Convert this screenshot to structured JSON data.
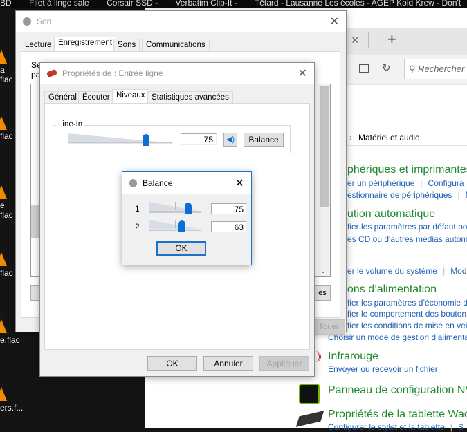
{
  "taskbar": {
    "items": [
      "BD",
      "Filet à linge sale",
      "Corsair SSD -",
      "Verbatim Clip-It -",
      "Têtard - Lausanne Les écoles - AGEP  Kold Krew - Don't"
    ]
  },
  "desktop": {
    "labels": [
      "a",
      "flac",
      "flac",
      "e",
      "flac",
      "flac",
      "e.flac",
      "ers.f..."
    ]
  },
  "browser": {
    "tab_close": "×",
    "new_tab": "+",
    "search_placeholder": "Rechercher"
  },
  "control_panel": {
    "breadcrumb": "Matériel et audio",
    "sections": [
      {
        "title": "phériques et imprimantes",
        "links": [
          [
            "er un périphérique",
            "Configura"
          ],
          [
            "estionnaire de périphériques",
            "M"
          ]
        ]
      },
      {
        "title": "ution automatique",
        "links": [
          [
            "fier les paramètres par défaut pou"
          ],
          [
            "es CD ou d'autres médias autom"
          ]
        ]
      },
      {
        "title": "",
        "links": [
          [
            "er le volume du système",
            "Mod"
          ]
        ]
      },
      {
        "title": "ons d’alimentation",
        "links": [
          [
            "fier les paramètres d’économie d"
          ],
          [
            "fier le comportement des bouton"
          ],
          [
            "fier les conditions de mise en veil"
          ],
          [
            "Choisir un mode de gestion d’alimenta"
          ]
        ]
      },
      {
        "title": "Infrarouge",
        "links": [
          [
            "Envoyer ou recevoir un fichier"
          ]
        ]
      },
      {
        "title": "Panneau de configuration NV",
        "links": []
      },
      {
        "title": "Propriétés de la tablette Wac",
        "links": [
          [
            "Configurer le stylet et la tablette",
            "S"
          ]
        ]
      }
    ],
    "colors": {
      "heading": "#1e8a2e",
      "link": "#1e5fb4"
    }
  },
  "son_dialog": {
    "title": "Son",
    "tabs": [
      "Lecture",
      "Enregistrement",
      "Sons",
      "Communications"
    ],
    "active_tab": "Enregistrement",
    "intro_start": "Sé",
    "intro_line2": "pa",
    "props_button_fragment": "és",
    "apply": "liquer"
  },
  "props_dialog": {
    "title": "Propriétés de : Entrée ligne",
    "tabs": [
      "Général",
      "Écouter",
      "Niveaux",
      "Statistiques avancées"
    ],
    "active_tab": "Niveaux",
    "group_label": "Line-In",
    "level": 75,
    "balance_button": "Balance",
    "ok": "OK",
    "cancel": "Annuler",
    "apply": "Appliquer"
  },
  "balance_dialog": {
    "title": "Balance",
    "channels": [
      {
        "label": "1",
        "value": 75
      },
      {
        "label": "2",
        "value": 63
      }
    ],
    "ok": "OK",
    "accent": "#0b6fd6"
  }
}
